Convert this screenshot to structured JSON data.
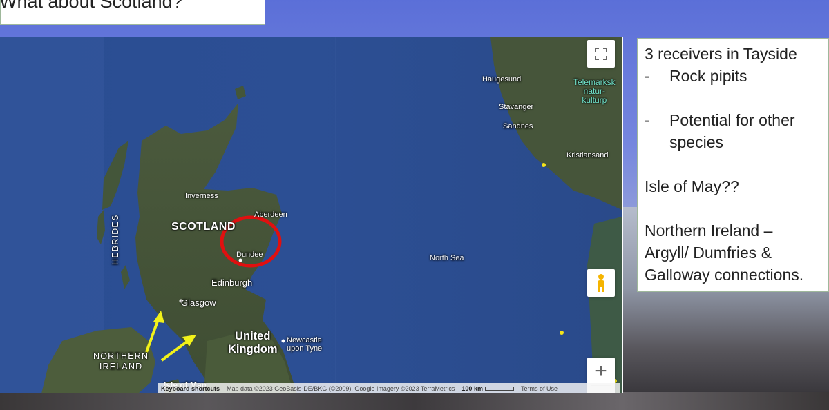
{
  "slide": {
    "title": "What about Scotland?"
  },
  "notes": {
    "line1": "3 receivers in Tayside",
    "bullet1_dash": "-",
    "bullet1_text": "Rock pipits",
    "bullet2_dash": "-",
    "bullet2_text_a": "Potential for other",
    "bullet2_text_b": "species",
    "isle": "Isle of May??",
    "ni_a": "Northern Ireland –",
    "ni_b": "Argyll/ Dumfries &",
    "ni_c": "Galloway connections."
  },
  "map": {
    "labels": {
      "scotland": "SCOTLAND",
      "hebrides": "HEBRIDES",
      "inverness": "Inverness",
      "aberdeen": "Aberdeen",
      "dundee": "Dundee",
      "edinburgh": "Edinburgh",
      "glasgow": "Glasgow",
      "uk_line1": "United",
      "uk_line2": "Kingdom",
      "newcastle_line1": "Newcastle",
      "newcastle_line2": "upon Tyne",
      "northern_ireland_line1": "NORTHERN",
      "northern_ireland_line2": "IRELAND",
      "isle_of_man": "Isle of Man",
      "north_sea": "North Sea",
      "haugesund": "Haugesund",
      "stavanger": "Stavanger",
      "sandnes": "Sandnes",
      "kristiansand": "Kristiansand",
      "telemark_line1": "Telemarksk",
      "telemark_line2": "natur-",
      "telemark_line3": "kulturp"
    },
    "controls": {
      "fullscreen_icon": "fullscreen-icon",
      "pegman_icon": "pegman-icon",
      "zoom_in": "+",
      "zoom_out": "−"
    },
    "attribution": {
      "keyboard": "Keyboard shortcuts",
      "data": "Map data ©2023 GeoBasis-DE/BKG (©2009), Google Imagery ©2023 TerraMetrics",
      "scale": "100 km",
      "terms": "Terms of Use"
    },
    "colors": {
      "sea": "#284a8c",
      "land": "#4a5a38",
      "highlight_circle": "#e01010",
      "arrows": "#f2f21a",
      "receiver_dots": "#f4e41a"
    }
  }
}
